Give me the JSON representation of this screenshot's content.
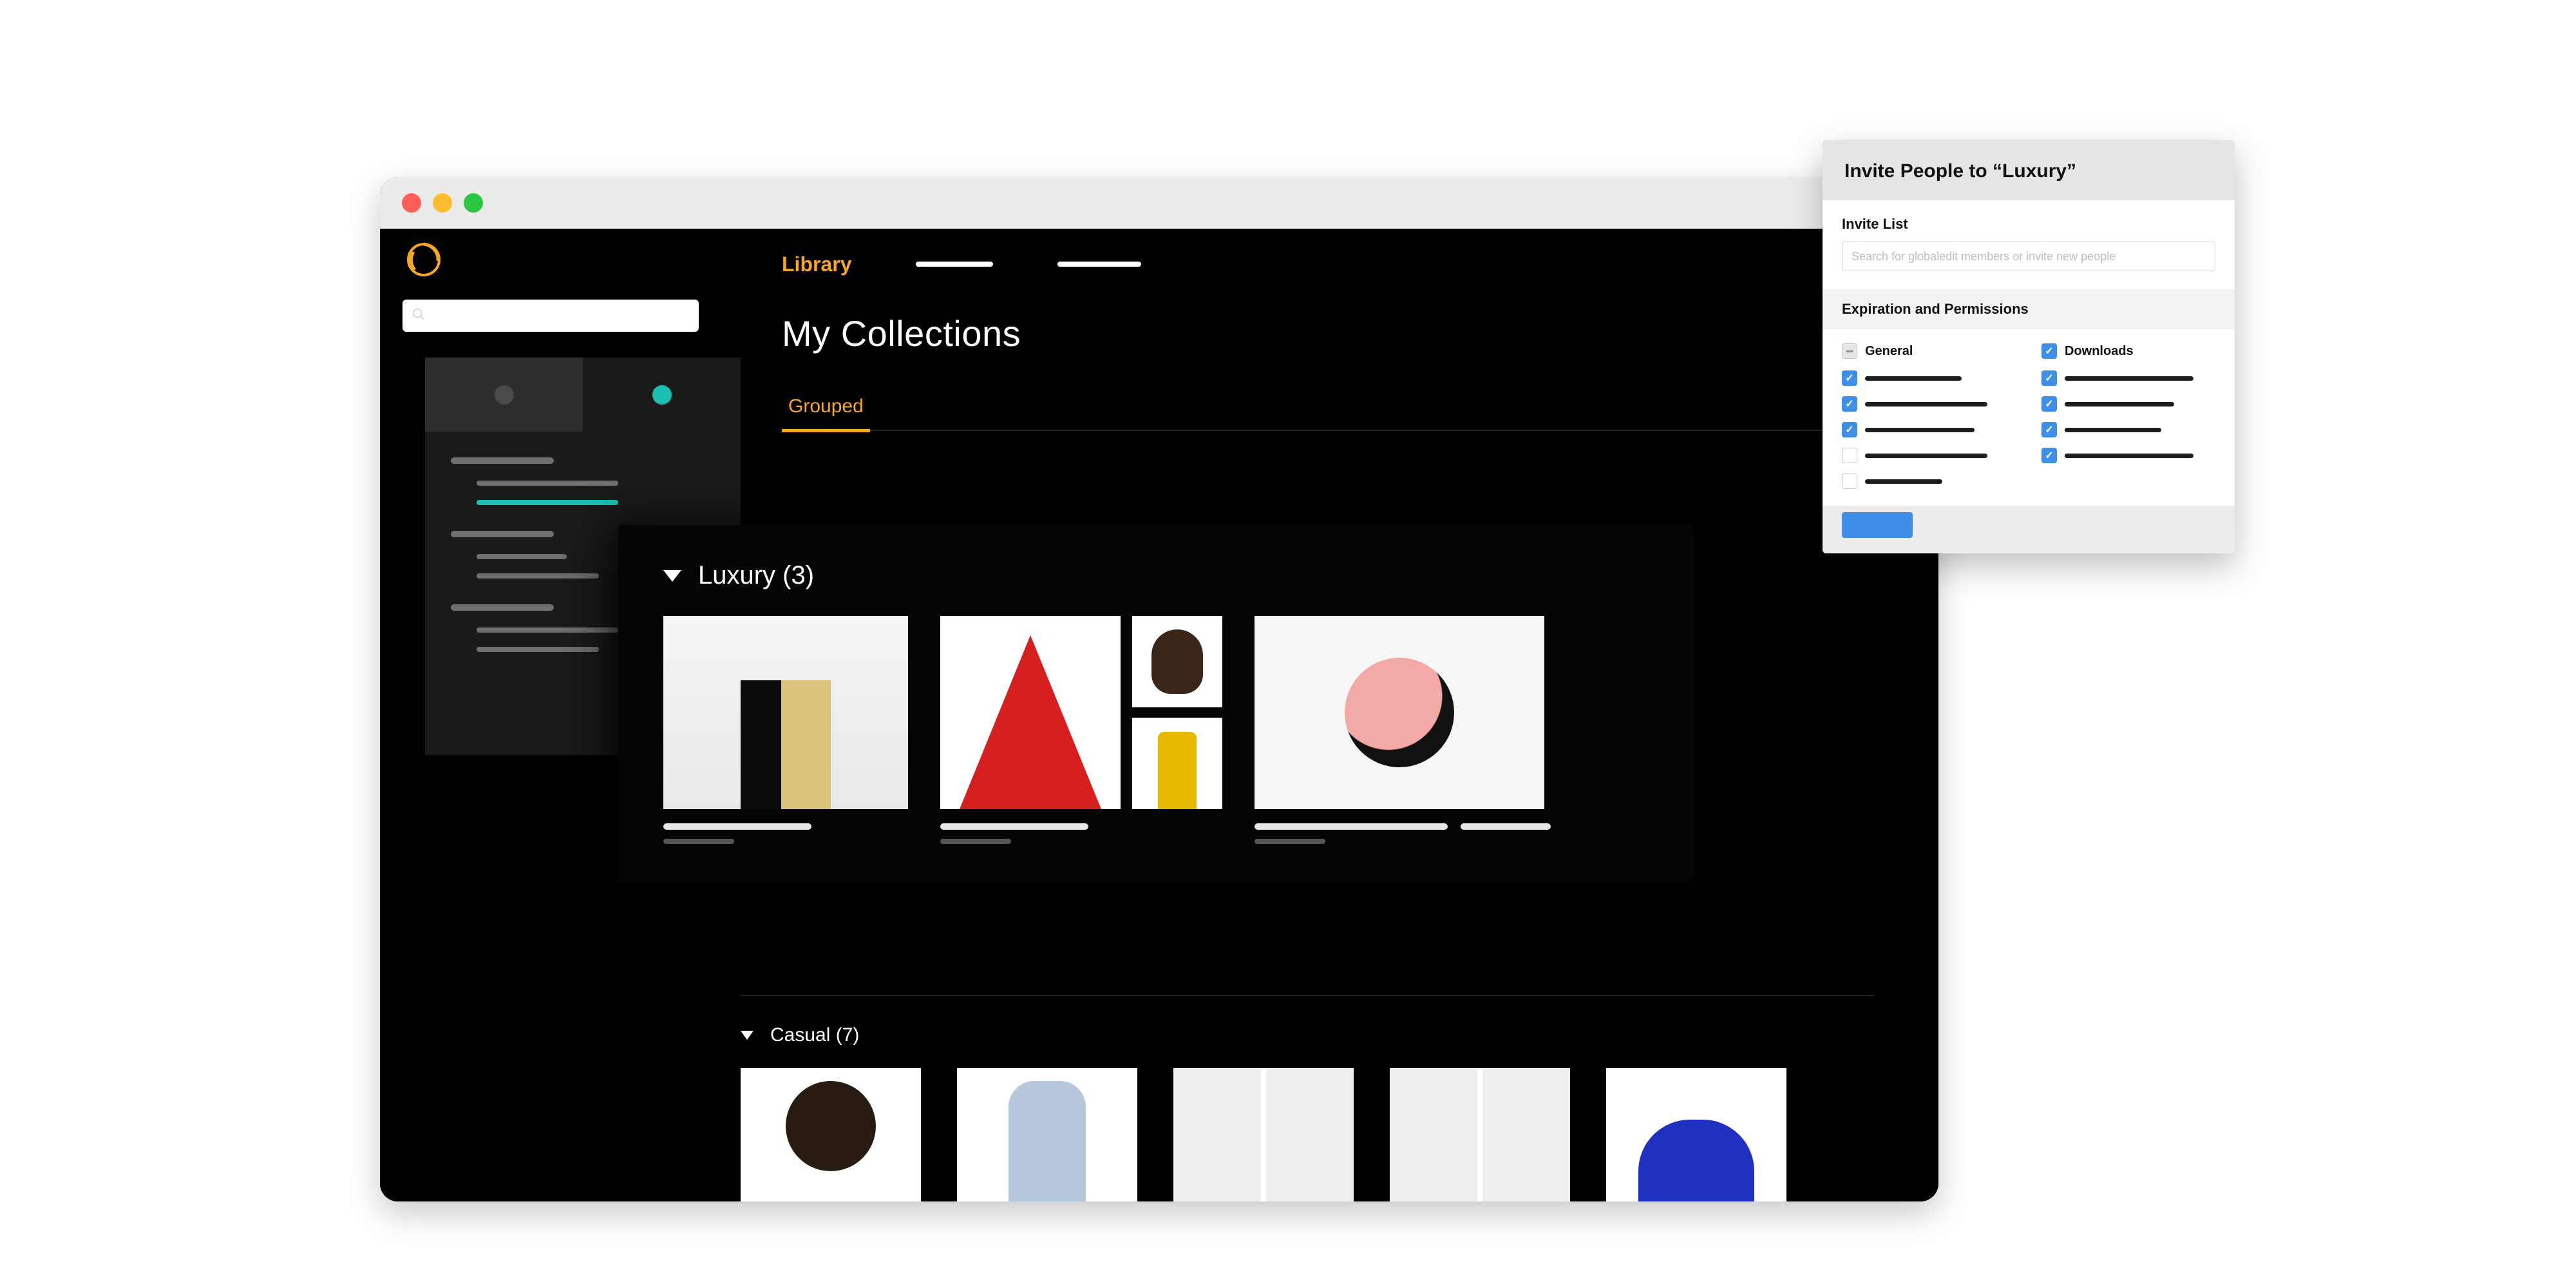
{
  "nav": {
    "library": "Library"
  },
  "page": {
    "title": "My Collections",
    "subtab_grouped": "Grouped"
  },
  "groups": {
    "luxury": {
      "title": "Luxury (3)"
    },
    "casual": {
      "title": "Casual (7)"
    }
  },
  "invite": {
    "title": "Invite People to “Luxury”",
    "list_label": "Invite List",
    "search_placeholder": "Search for globaledit members or invite new people",
    "section_label": "Expiration and Permissions",
    "col_general": "General",
    "col_downloads": "Downloads"
  }
}
